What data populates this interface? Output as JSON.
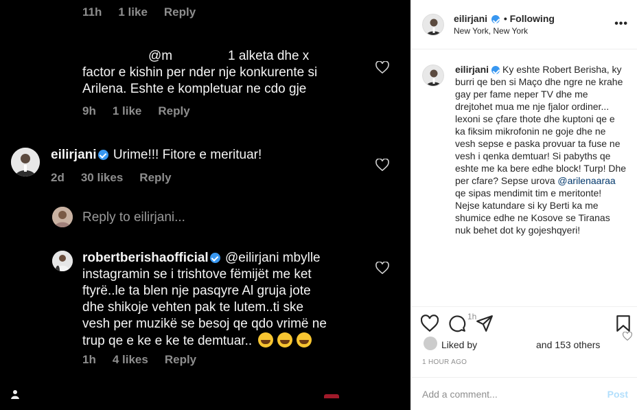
{
  "photo": {
    "c0": {
      "time": "11h",
      "likes": "1 like",
      "reply": "Reply"
    },
    "c1": {
      "text_line1_a": "@m",
      "text_line1_b": "1 alketa dhe x",
      "text_line2": "factor e kishin per nder nje konkurente si",
      "text_line3": "Arilena. Eshte e kompletuar ne cdo gje",
      "time": "9h",
      "likes": "1 like",
      "reply": "Reply"
    },
    "c2": {
      "user": "eilirjani",
      "text": "Urime!!! Fitore e merituar!",
      "time": "2d",
      "likes": "30 likes",
      "reply": "Reply"
    },
    "reply_to": "Reply to eilirjani...",
    "c3": {
      "user": "robertberishaofficial",
      "line1": "@eilirjani mbylle",
      "line2": "instagramin se i trishtove fëmijët me ket",
      "line3": "ftyrë..le ta blen nje pasqyre Al gruja jote",
      "line4": "dhe shikoje vehten pak te lutem..ti ske",
      "line5": "vesh per muzikë se besoj qe qdo vrimë ne",
      "line6": "trup qe e ke e ke te demtuar..",
      "time": "1h",
      "likes": "4 likes",
      "reply": "Reply"
    }
  },
  "panel": {
    "header": {
      "username": "eilirjani",
      "follow_status": "Following",
      "location": "New York, New York",
      "more": "•••"
    },
    "caption": {
      "username": "eilirjani",
      "text_a": "Ky eshte Robert Berisha, ky burri qe ben si Maço dhe ngre ne krahe gay per fame neper TV dhe me drejtohet mua me nje fjalor ordiner... lexoni se çfare thote dhe kuptoni qe e ka fiksim mikrofonin ne goje dhe ne vesh sepse e paska provuar ta fuse ne vesh i qenka demtuar! Si pabyths qe eshte me ka bere edhe block! Turp! Dhe per cfare? Sepse urova ",
      "mention": "@arilenaaraa",
      "text_b": " qe sipas mendimit tim e meritonte! Nejse katundare si ky Berti ka me shumice edhe ne Kosove se Tiranas nuk behet dot ky gojeshqyeri!",
      "time": "1h"
    },
    "likes": {
      "liked_by": "Liked by",
      "and_others": "and 153 others"
    },
    "ago": "1 HOUR AGO",
    "comment": {
      "placeholder": "Add a comment...",
      "post": "Post"
    }
  }
}
